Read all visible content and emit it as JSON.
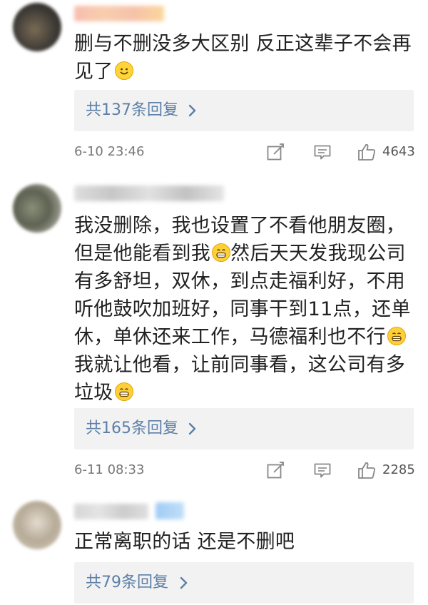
{
  "comments": [
    {
      "content_lines": [
        "删与不删没多大区别  反正这辈子不会再",
        "见了"
      ],
      "emoji": "smile-emoji",
      "reply_label": "共137条回复",
      "timestamp": "6-10 23:46",
      "likes": "4643"
    },
    {
      "content_lines": [
        "我没删除，我也设置了不看他朋友圈，",
        "但是他能看到我",
        "然后天天发我现公司",
        "有多舒坦，双休，到点走福利好，不用",
        "听他鼓吹加班好，同事干到11点，还单",
        "休，单休还来工作，马德福利也不行",
        "我就让他看，让前同事看，这公司有多",
        "垃圾"
      ],
      "emoji": "grin-emoji",
      "reply_label": "共165条回复",
      "timestamp": "6-11 08:33",
      "likes": "2285"
    },
    {
      "content_lines": [
        "正常离职的话 还是不删吧"
      ],
      "reply_label": "共79条回复"
    }
  ],
  "colors": {
    "reply_link": "#5c7fa8",
    "reply_bg": "#f2f2f2",
    "meta_text": "#777777"
  },
  "icons": [
    "edit-icon",
    "comment-icon",
    "thumbs-up-icon",
    "chevron-right-icon"
  ]
}
